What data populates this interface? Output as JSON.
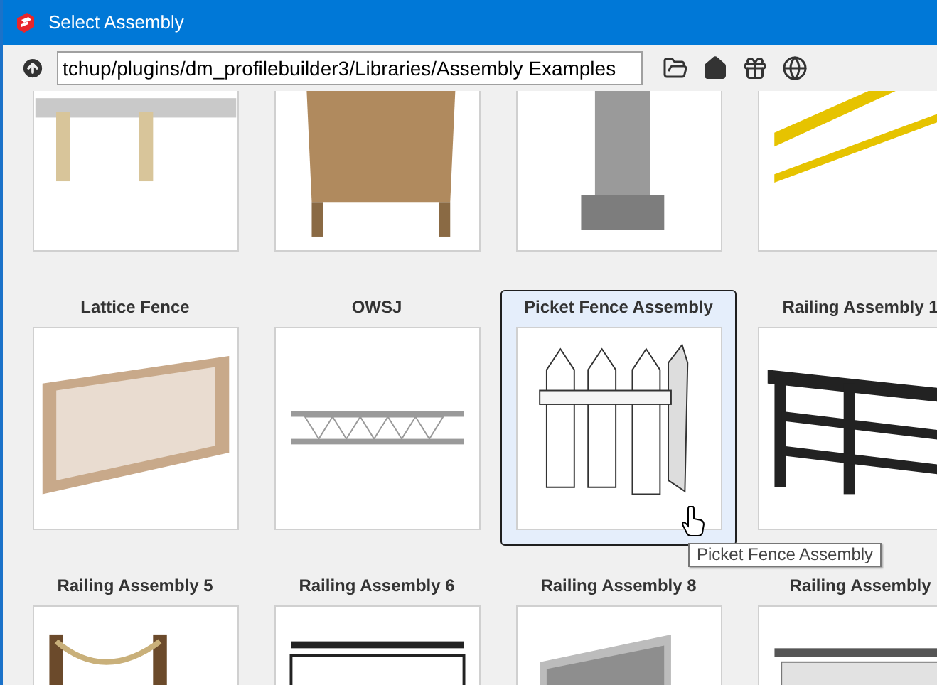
{
  "window": {
    "title": "Select Assembly"
  },
  "toolbar": {
    "path": "tchup/plugins/dm_profilebuilder3/Libraries/Assembly Examples"
  },
  "items": [
    {
      "selected": false
    },
    {
      "selected": false
    },
    {
      "selected": false
    },
    {
      "selected": false
    },
    {
      "title": "Lattice Fence",
      "selected": false
    },
    {
      "title": "OWSJ",
      "selected": false
    },
    {
      "title": "Picket Fence Assembly",
      "selected": true
    },
    {
      "title": "Railing Assembly 1",
      "selected": false
    },
    {
      "title": "Railing Assembly 5",
      "selected": false
    },
    {
      "title": "Railing Assembly 6",
      "selected": false
    },
    {
      "title": "Railing Assembly 8",
      "selected": false
    },
    {
      "title": "Railing Assembly",
      "selected": false
    }
  ],
  "tooltip": {
    "text": "Picket Fence Assembly"
  }
}
